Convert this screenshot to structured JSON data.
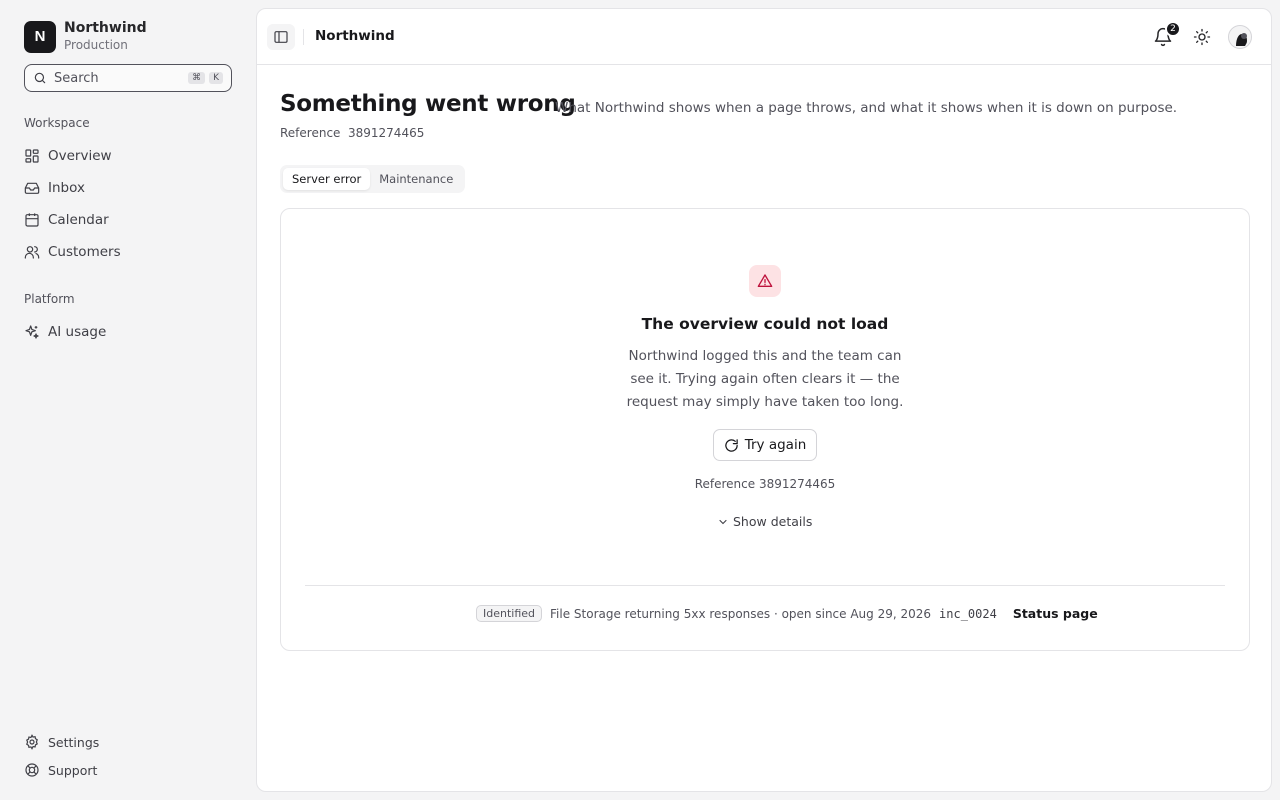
{
  "org": {
    "initial": "N",
    "name": "Northwind",
    "environment": "Production"
  },
  "search": {
    "label": "Search",
    "shortcut_mod": "⌘",
    "shortcut_key": "K"
  },
  "sidebar": {
    "workspace_label": "Workspace",
    "workspace_items": [
      {
        "label": "Overview",
        "icon": "layout-grid-icon"
      },
      {
        "label": "Inbox",
        "icon": "inbox-icon"
      },
      {
        "label": "Calendar",
        "icon": "calendar-icon"
      },
      {
        "label": "Customers",
        "icon": "users-icon"
      }
    ],
    "platform_label": "Platform",
    "platform_items": [
      {
        "label": "AI usage",
        "icon": "sparkles-icon"
      }
    ],
    "footer_items": [
      {
        "label": "Settings",
        "icon": "gear-icon"
      },
      {
        "label": "Support",
        "icon": "lifebuoy-icon"
      }
    ]
  },
  "topbar": {
    "breadcrumb": "Northwind",
    "notification_count": "2"
  },
  "page": {
    "title": "Something went wrong",
    "subtitle": "What Northwind shows when a page throws, and what it shows when it is down on purpose.",
    "reference_label": "Reference",
    "reference_value": "3891274465"
  },
  "tabs": [
    {
      "label": "Server error",
      "active": true
    },
    {
      "label": "Maintenance",
      "active": false
    }
  ],
  "error_card": {
    "title": "The overview could not load",
    "body": "Northwind logged this and the team can see it. Trying again often clears it — the request may simply have taken too long.",
    "retry_label": "Try again",
    "reference_line": "Reference 3891274465",
    "details_label": "Show details",
    "incident": {
      "status": "Identified",
      "description": "File Storage returning 5xx responses · open since Aug 29, 2026",
      "id": "inc_0024",
      "link_label": "Status page"
    }
  },
  "colors": {
    "accent": "#18181b",
    "danger_bg": "#fde2e4",
    "danger": "#be123c"
  }
}
